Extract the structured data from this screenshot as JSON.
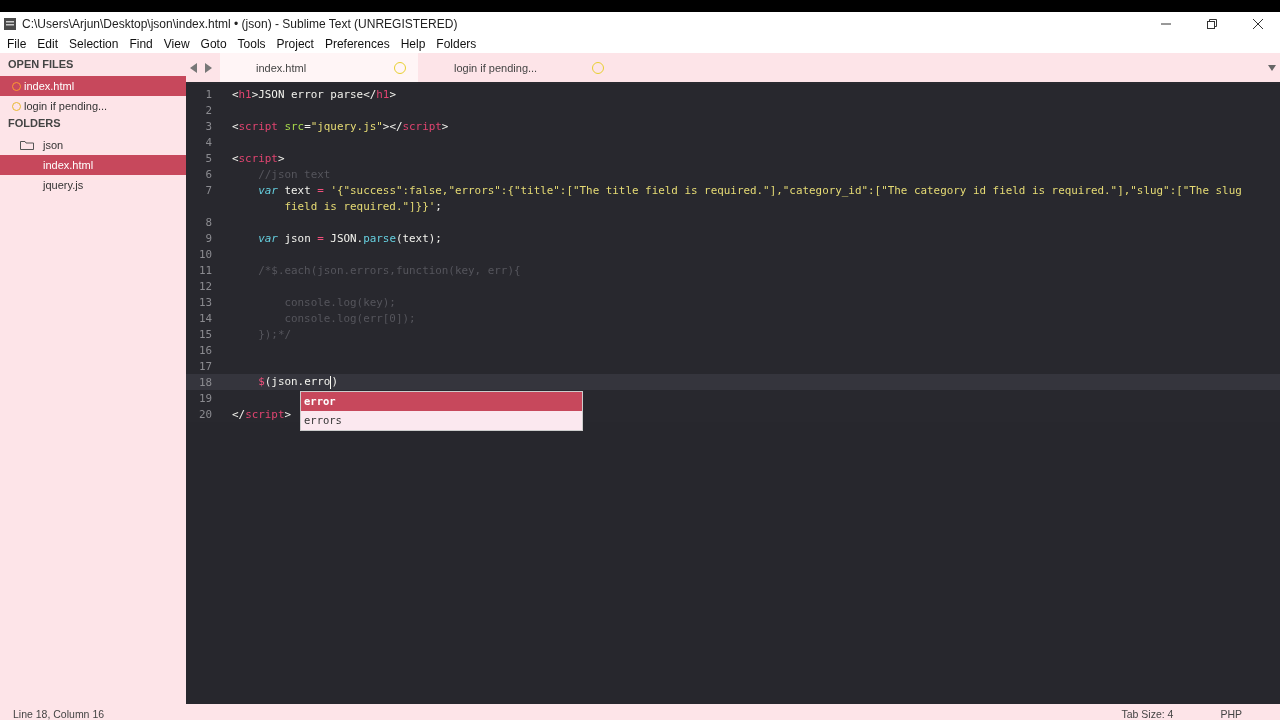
{
  "window": {
    "title": "C:\\Users\\Arjun\\Desktop\\json\\index.html • (json) - Sublime Text (UNREGISTERED)"
  },
  "menu": [
    "File",
    "Edit",
    "Selection",
    "Find",
    "View",
    "Goto",
    "Tools",
    "Project",
    "Preferences",
    "Help",
    "Folders"
  ],
  "sidebar": {
    "open_files_heading": "OPEN FILES",
    "open_files": [
      {
        "label": "index.html",
        "selected": true
      },
      {
        "label": "login if pending...",
        "selected": false
      }
    ],
    "folders_heading": "FOLDERS",
    "folders": [
      {
        "label": "json",
        "kind": "folder",
        "children": [
          {
            "label": "index.html",
            "kind": "file",
            "selected": true
          },
          {
            "label": "jquery.js",
            "kind": "file",
            "selected": false
          }
        ]
      }
    ]
  },
  "tabs": [
    {
      "label": "index.html",
      "selected": true,
      "dirty": true
    },
    {
      "label": "login if pending...",
      "selected": false,
      "dirty": true
    }
  ],
  "editor": {
    "lines": [
      {
        "number": "1",
        "current": false,
        "tokens": [
          {
            "kind": "punct",
            "text": "<"
          },
          {
            "kind": "tag",
            "text": "h1"
          },
          {
            "kind": "punct",
            "text": ">JSON error parse</"
          },
          {
            "kind": "tag",
            "text": "h1"
          },
          {
            "kind": "punct",
            "text": ">"
          }
        ]
      },
      {
        "number": "2",
        "current": false
      },
      {
        "number": "3",
        "current": false,
        "tokens": [
          {
            "kind": "punct",
            "text": "<"
          },
          {
            "kind": "tag",
            "text": "script"
          },
          {
            "kind": "attr",
            "text": " src"
          },
          {
            "kind": "punct",
            "text": "="
          },
          {
            "kind": "string",
            "text": "\"jquery.js\""
          },
          {
            "kind": "punct",
            "text": "></"
          },
          {
            "kind": "tag",
            "text": "script"
          },
          {
            "kind": "punct",
            "text": ">"
          }
        ]
      },
      {
        "number": "4",
        "current": false
      },
      {
        "number": "5",
        "current": false,
        "tokens": [
          {
            "kind": "punct",
            "text": "<"
          },
          {
            "kind": "tag",
            "text": "script"
          },
          {
            "kind": "punct",
            "text": ">"
          }
        ]
      },
      {
        "number": "6",
        "current": false,
        "tokens": [
          {
            "kind": "comment",
            "text": "    //json text"
          }
        ]
      },
      {
        "number": "7",
        "current": false,
        "tokens": [
          {
            "kind": "storage",
            "text": "    var"
          },
          {
            "kind": "punct",
            "text": " text "
          },
          {
            "kind": "op",
            "text": "= "
          },
          {
            "kind": "string",
            "text": "'{\"success\":false,\"errors\":{\"title\":[\"The title field is required.\"],\"category_id\":[\"The category id field is required.\"],\"slug\":[\"The slug"
          }
        ],
        "continuation": [
          {
            "kind": "string",
            "text": "        field is required.\"]}}'"
          },
          {
            "kind": "punct",
            "text": ";"
          }
        ]
      },
      {
        "number": "8",
        "current": false
      },
      {
        "number": "9",
        "current": false,
        "tokens": [
          {
            "kind": "storage",
            "text": "    var"
          },
          {
            "kind": "punct",
            "text": " json "
          },
          {
            "kind": "op",
            "text": "="
          },
          {
            "kind": "punct",
            "text": " JSON."
          },
          {
            "kind": "func",
            "text": "parse"
          },
          {
            "kind": "punct",
            "text": "(text);"
          }
        ]
      },
      {
        "number": "10",
        "current": false
      },
      {
        "number": "11",
        "current": false,
        "tokens": [
          {
            "kind": "comment",
            "text": "    /*$.each(json.errors,function(key, err){"
          }
        ]
      },
      {
        "number": "12",
        "current": false
      },
      {
        "number": "13",
        "current": false,
        "tokens": [
          {
            "kind": "comment",
            "text": "        console.log(key);"
          }
        ]
      },
      {
        "number": "14",
        "current": false,
        "tokens": [
          {
            "kind": "comment",
            "text": "        console.log(err[0]);"
          }
        ]
      },
      {
        "number": "15",
        "current": false,
        "tokens": [
          {
            "kind": "comment",
            "text": "    });*/"
          }
        ]
      },
      {
        "number": "16",
        "current": false
      },
      {
        "number": "17",
        "current": false
      },
      {
        "number": "18",
        "current": true,
        "tokens": [
          {
            "kind": "op",
            "text": "    $"
          },
          {
            "kind": "punct",
            "text": "(json.erro"
          },
          {
            "kind": "caret"
          },
          {
            "kind": "punct",
            "text": ")"
          }
        ],
        "autocomplete": [
          {
            "label": "error",
            "selected": true
          },
          {
            "label": "errors",
            "selected": false
          }
        ]
      },
      {
        "number": "19",
        "current": false
      },
      {
        "number": "20",
        "current": false,
        "tokens": [
          {
            "kind": "punct",
            "text": "</"
          },
          {
            "kind": "tag",
            "text": "script"
          },
          {
            "kind": "punct",
            "text": ">"
          }
        ]
      }
    ]
  },
  "status_bar": {
    "position": "Line 18, Column 16",
    "tab_size": "Tab Size: 4",
    "syntax": "PHP"
  }
}
